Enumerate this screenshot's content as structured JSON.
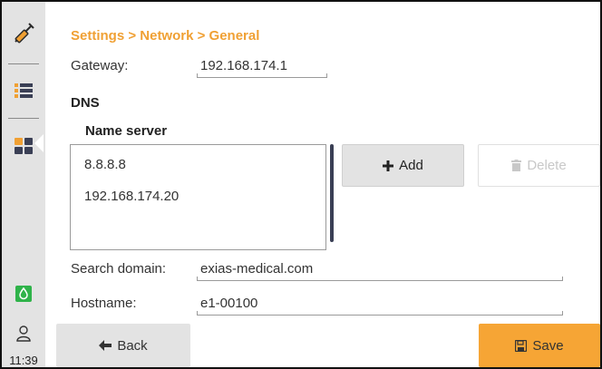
{
  "breadcrumb": "Settings > Network > General",
  "gateway": {
    "label": "Gateway:",
    "value": "192.168.174.1"
  },
  "dns": {
    "heading": "DNS",
    "name_server_label": "Name server",
    "servers": [
      "8.8.8.8",
      "192.168.174.20"
    ],
    "add_label": "Add",
    "delete_label": "Delete"
  },
  "search_domain": {
    "label": "Search domain:",
    "value": "exias-medical.com"
  },
  "hostname": {
    "label": "Hostname:",
    "value": "e1-00100"
  },
  "footer": {
    "back_label": "Back",
    "save_label": "Save"
  },
  "sidebar": {
    "icons": [
      "syringe-icon",
      "list-icon",
      "grid-icon",
      "drop-icon",
      "user-icon"
    ],
    "time": "11:39"
  },
  "colors": {
    "accent": "#f6a535",
    "breadcrumb": "#f0a033",
    "sidebar_bg": "#e3e3e3",
    "status_green": "#2fb34a",
    "scrollbar": "#3a3f55"
  }
}
